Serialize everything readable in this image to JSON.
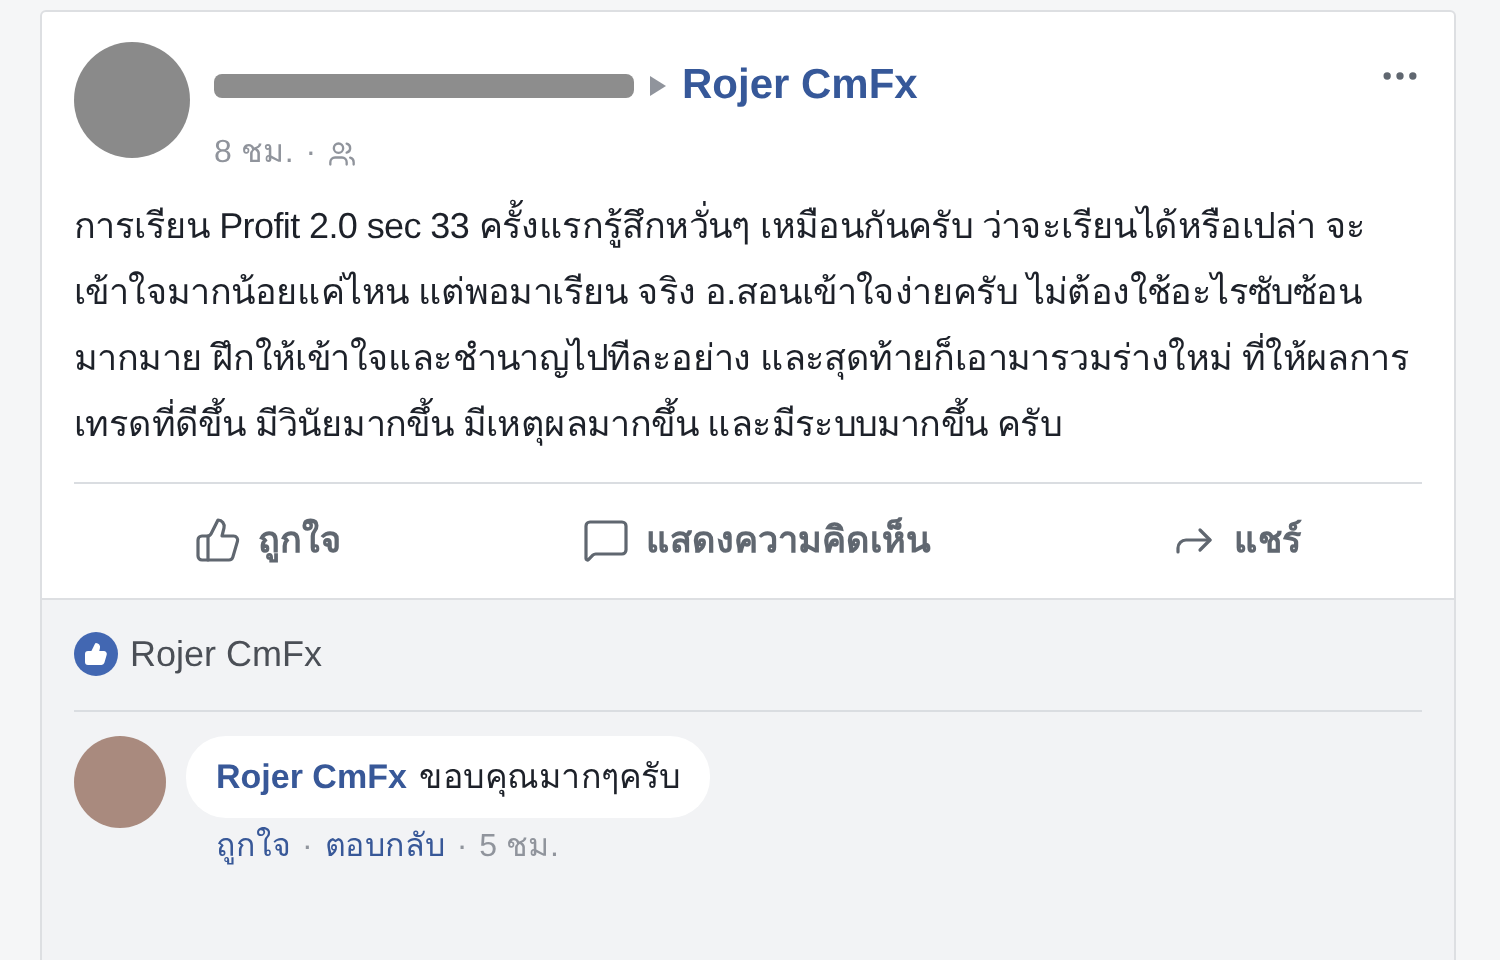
{
  "post": {
    "target": "Rojer CmFx",
    "time": "8 ชม.",
    "separator": "·",
    "body": "การเรียน Profit 2.0 sec 33 ครั้งแรกรู้สึกหวั่นๆ เหมือนกันครับ ว่าจะเรียนได้หรือเปล่า จะเข้าใจมากน้อยแค่ไหน แต่พอมาเรียน จริง อ.สอนเข้าใจง่ายครับ ไม่ต้องใช้อะไรซับซ้อนมากมาย ฝึกให้เข้าใจและชำนาญไปทีละอย่าง และสุดท้ายก็เอามารวมร่างใหม่ ที่ให้ผลการเทรดที่ดีขึ้น มีวินัยมากขึ้น มีเหตุผลมากขึ้น และมีระบบมากขึ้น ครับ"
  },
  "actions": [
    {
      "kind": "like",
      "label": "ถูกใจ"
    },
    {
      "kind": "comment",
      "label": "แสดงความคิดเห็น"
    },
    {
      "kind": "share",
      "label": "แชร์"
    }
  ],
  "likes": {
    "names": "Rojer CmFx"
  },
  "comments": [
    {
      "author": "Rojer CmFx",
      "text": "ขอบคุณมากๆครับ",
      "like": "ถูกใจ",
      "separators": [
        "·",
        "·"
      ],
      "reply": "ตอบกลับ",
      "time": "5 ชม."
    }
  ]
}
